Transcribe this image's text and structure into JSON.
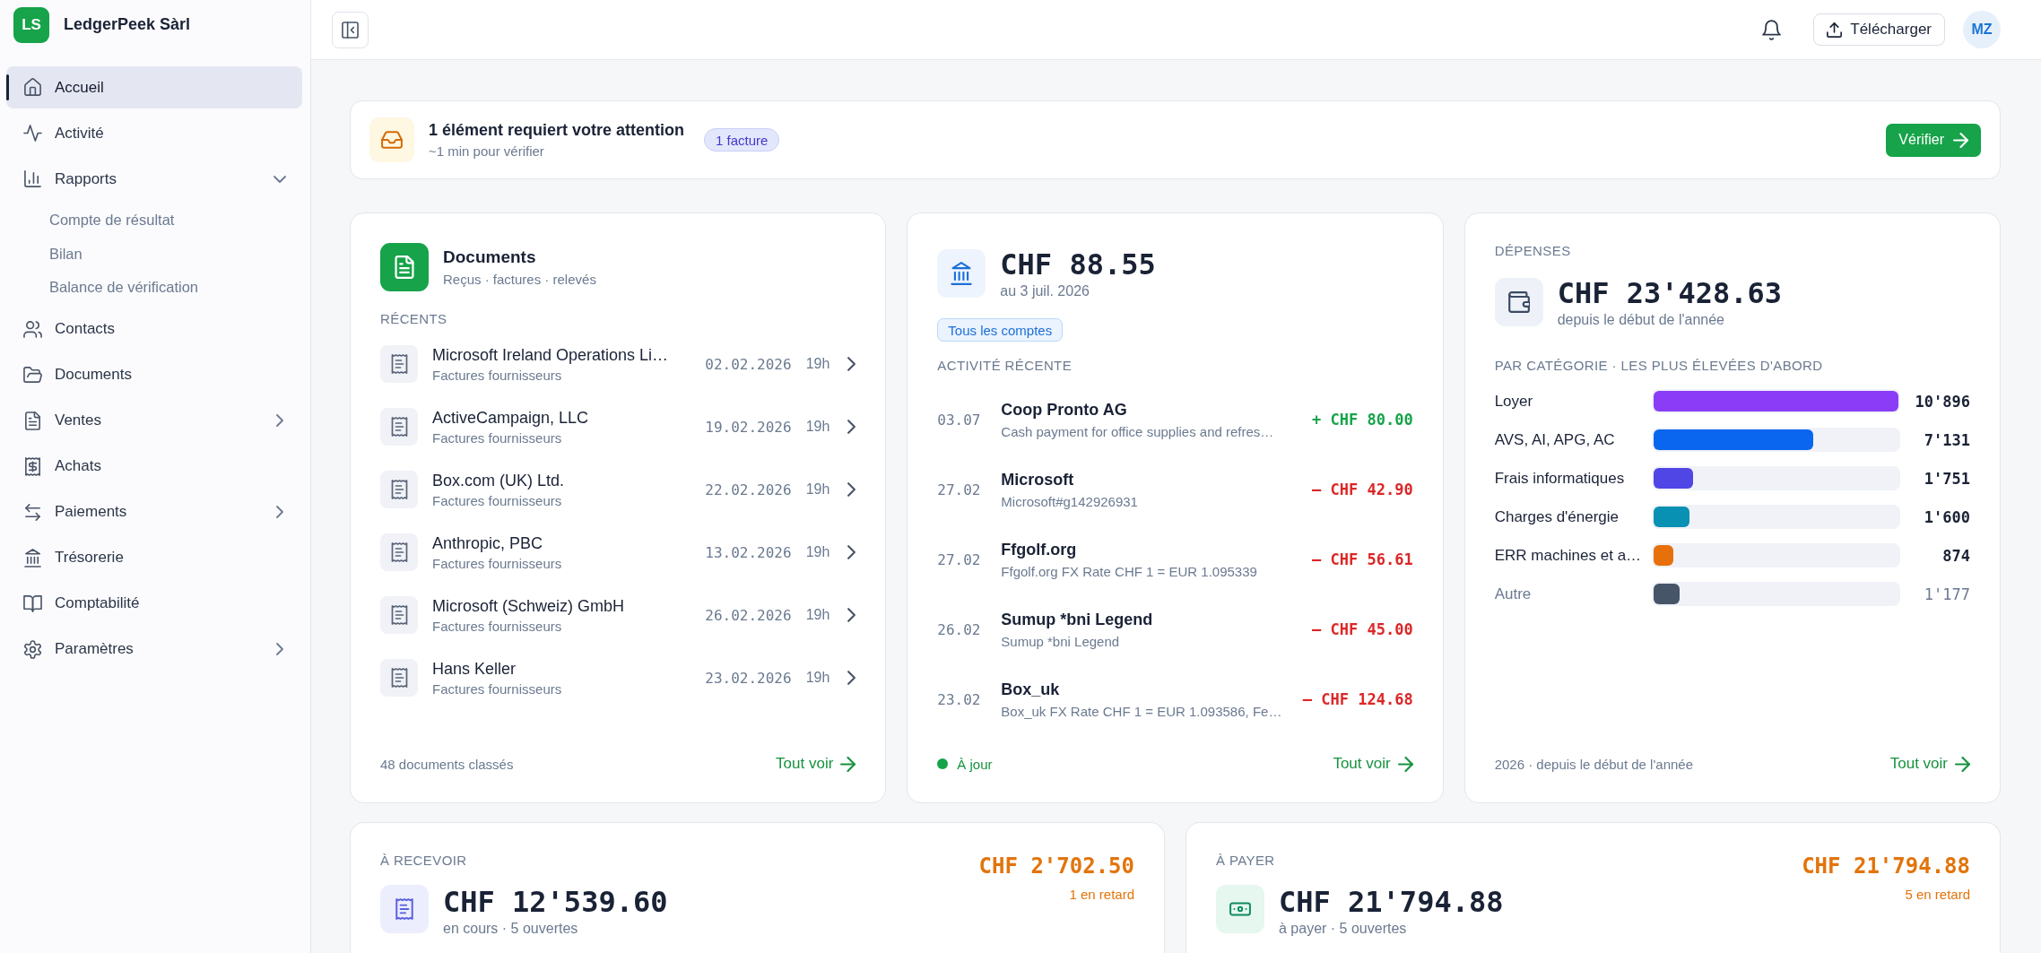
{
  "sidebar": {
    "logo": "LS",
    "company": "LedgerPeek Sàrl",
    "items": [
      {
        "label": "Accueil",
        "kind": "link",
        "selected": true
      },
      {
        "label": "Activité",
        "kind": "link",
        "selected": false
      },
      {
        "label": "Rapports",
        "kind": "group",
        "selected": false,
        "expanded": true,
        "children": [
          {
            "label": "Compte de résultat",
            "selected": false
          },
          {
            "label": "Bilan",
            "selected": false
          },
          {
            "label": "Balance de vérification",
            "selected": false
          }
        ]
      },
      {
        "label": "Contacts",
        "kind": "link",
        "selected": false
      },
      {
        "label": "Documents",
        "kind": "link",
        "selected": false
      },
      {
        "label": "Ventes",
        "kind": "group",
        "selected": false,
        "expanded": false
      },
      {
        "label": "Achats",
        "kind": "link",
        "selected": false
      },
      {
        "label": "Paiements",
        "kind": "group",
        "selected": false,
        "expanded": false
      },
      {
        "label": "Trésorerie",
        "kind": "link",
        "selected": false
      },
      {
        "label": "Comptabilité",
        "kind": "link",
        "selected": false
      },
      {
        "label": "Paramètres",
        "kind": "group",
        "selected": false,
        "expanded": false
      }
    ]
  },
  "header": {
    "download_button": "Télécharger",
    "avatar": "MZ"
  },
  "attention": {
    "title": "1 élément requiert votre attention",
    "subtitle": "~1 min pour vérifier",
    "badge": "1 facture",
    "button": "Vérifier"
  },
  "documents": {
    "title": "Documents",
    "subtitle": "Reçus · factures · relevés",
    "section": "RÉCENTS",
    "rows": [
      {
        "name": "Microsoft Ireland Operations Li…",
        "category": "Factures fournisseurs",
        "date": "02.02.2026",
        "time": "19h"
      },
      {
        "name": "ActiveCampaign, LLC",
        "category": "Factures fournisseurs",
        "date": "19.02.2026",
        "time": "19h"
      },
      {
        "name": "Box.com (UK) Ltd.",
        "category": "Factures fournisseurs",
        "date": "22.02.2026",
        "time": "19h"
      },
      {
        "name": "Anthropic, PBC",
        "category": "Factures fournisseurs",
        "date": "13.02.2026",
        "time": "19h"
      },
      {
        "name": "Microsoft (Schweiz) GmbH",
        "category": "Factures fournisseurs",
        "date": "26.02.2026",
        "time": "19h"
      },
      {
        "name": "Hans Keller",
        "category": "Factures fournisseurs",
        "date": "23.02.2026",
        "time": "19h"
      }
    ],
    "footer": "48 documents classés",
    "link": "Tout voir"
  },
  "bank": {
    "balance": "CHF 88.55",
    "as_of": "au 3 juil. 2026",
    "account_filter": "Tous les comptes",
    "section": "ACTIVITÉ RÉCENTE",
    "transactions": [
      {
        "date": "03.07",
        "payee": "Coop Pronto AG",
        "memo": "Cash payment for office supplies and refres…",
        "amount": "+ CHF 80.00",
        "kind": "credit"
      },
      {
        "date": "27.02",
        "payee": "Microsoft",
        "memo": "Microsoft#g142926931",
        "amount": "– CHF 42.90",
        "kind": "debit"
      },
      {
        "date": "27.02",
        "payee": "Ffgolf.org",
        "memo": "Ffgolf.org FX Rate CHF 1 = EUR 1.095339",
        "amount": "– CHF 56.61",
        "kind": "debit"
      },
      {
        "date": "26.02",
        "payee": "Sumup *bni Legend",
        "memo": "Sumup *bni Legend",
        "amount": "– CHF 45.00",
        "kind": "debit"
      },
      {
        "date": "23.02",
        "payee": "Box_uk",
        "memo": "Box_uk FX Rate CHF 1 = EUR 1.093586, Fe…",
        "amount": "– CHF 124.68",
        "kind": "debit"
      }
    ],
    "status": {
      "label": "À jour",
      "ok": true
    },
    "link": "Tout voir"
  },
  "expenses": {
    "section": "DÉPENSES",
    "total": "CHF 23'428.63",
    "period": "depuis le début de l'année",
    "breakdown_title": "PAR CATÉGORIE · LES PLUS ÉLEVÉES D'ABORD",
    "categories": [
      {
        "label": "Loyer",
        "value": "10'896",
        "level": 1,
        "color": "#8b3cf6",
        "dimmed": false
      },
      {
        "label": "AVS, AI, APG, AC",
        "value": "7'131",
        "level": 0.654,
        "color": "#0a66ee",
        "dimmed": false
      },
      {
        "label": "Frais informatiques",
        "value": "1'751",
        "level": 0.161,
        "color": "#4f46e5",
        "dimmed": false
      },
      {
        "label": "Charges d'énergie",
        "value": "1'600",
        "level": 0.147,
        "color": "#0891b2",
        "dimmed": false
      },
      {
        "label": "ERR machines et a…",
        "value": "874",
        "level": 0.08,
        "color": "#e8700a",
        "dimmed": false
      },
      {
        "label": "Autre",
        "value": "1'177",
        "level": 0.108,
        "color": "#475569",
        "dimmed": true
      }
    ],
    "footer": "2026 · depuis le début de l'année",
    "link": "Tout voir"
  },
  "balances": [
    {
      "section": "À RECEVOIR",
      "total": "CHF 12'539.60",
      "detail": "en cours · 5 ouvertes",
      "overdue_amount": "CHF 2'702.50",
      "overdue_count": "1 en retard"
    },
    {
      "section": "À PAYER",
      "total": "CHF 21'794.88",
      "detail": "à payer · 5 ouvertes",
      "overdue_amount": "CHF 21'794.88",
      "overdue_count": "5 en retard"
    }
  ]
}
